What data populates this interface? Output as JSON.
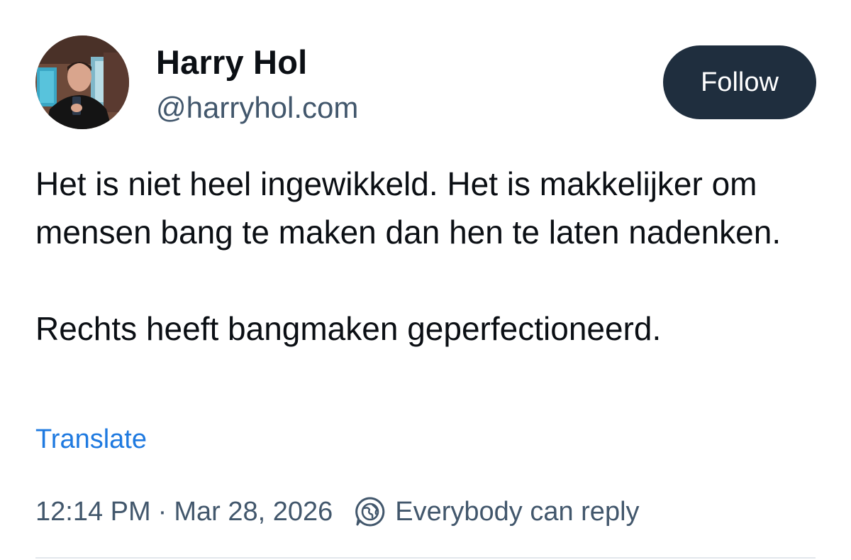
{
  "author": {
    "display_name": "Harry Hol",
    "handle": "@harryhol.com"
  },
  "follow_button": {
    "label": "Follow"
  },
  "post": {
    "paragraphs": [
      "Het is niet heel ingewikkeld. Het is makkelijker om mensen bang te maken dan hen te laten nadenken.",
      "Rechts heeft bangmaken geperfectioneerd."
    ],
    "translate_label": "Translate"
  },
  "meta": {
    "time": "12:14 PM",
    "separator": "·",
    "date": "Mar 28, 2026",
    "reply_setting": "Everybody can reply",
    "reply_icon": "globe-speech-icon"
  },
  "colors": {
    "follow_bg": "#1f2e3e",
    "link": "#1f7ae0",
    "muted_text": "#42576c"
  }
}
